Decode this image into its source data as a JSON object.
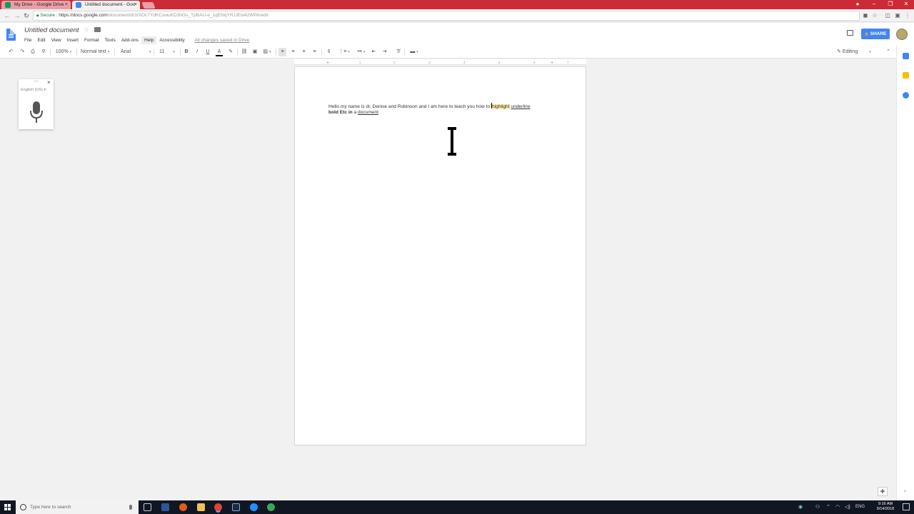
{
  "browser": {
    "tabs": [
      {
        "label": "My Drive - Google Drive",
        "close": "×"
      },
      {
        "label": "Untitled document - Goo",
        "close": "×"
      }
    ],
    "window_controls": {
      "minimize": "–",
      "maximize": "❐",
      "close": "✕"
    },
    "nav": {
      "back": "←",
      "forward": "→",
      "reload": "↻"
    },
    "address": {
      "secure_label": "Secure",
      "host": "https://docs.google.com",
      "path": "/document/d/1lXOcTYdKCxwuKD3hOu_TpBAU-e_1qENqYRJJEw42WPA/edit"
    }
  },
  "docs": {
    "title": "Untitled document",
    "menu": [
      "File",
      "Edit",
      "View",
      "Insert",
      "Format",
      "Tools",
      "Add-ons",
      "Help",
      "Accessibility"
    ],
    "save_status": "All changes saved in Drive",
    "share_label": "SHARE",
    "share_icon": "🔒",
    "toolbar": {
      "undo": "↶",
      "redo": "↷",
      "print": "⎙",
      "paint": "⚲",
      "zoom": "100%",
      "style": "Normal text",
      "font": "Arial",
      "size": "11",
      "bold": "B",
      "italic": "I",
      "underline": "U",
      "textcolor": "A",
      "mode": "Editing",
      "collapse": "⌃"
    },
    "voice": {
      "language": "English (US)",
      "close": "×",
      "dots": "⋯"
    },
    "ruler_ticks": [
      "1",
      "2",
      "3",
      "4",
      "5",
      "6",
      "7"
    ],
    "content": {
      "line1_plain": "Hello my name is dr. Denise and Robinson and I am here to teach you how to ",
      "line1_highlight": "highlight",
      "line1_italic_underline": "underline",
      "line2_bold": "bold Etc in",
      "line2_plain": " a ",
      "line2_underline": "document"
    }
  },
  "taskbar": {
    "search_placeholder": "Type here to search",
    "language": "ENG",
    "time": "9:16 AM",
    "date": "9/14/2018"
  },
  "colors": {
    "chrome_red": "#cc2a36",
    "docs_blue": "#4285f4",
    "highlight": "#fce8a6"
  }
}
